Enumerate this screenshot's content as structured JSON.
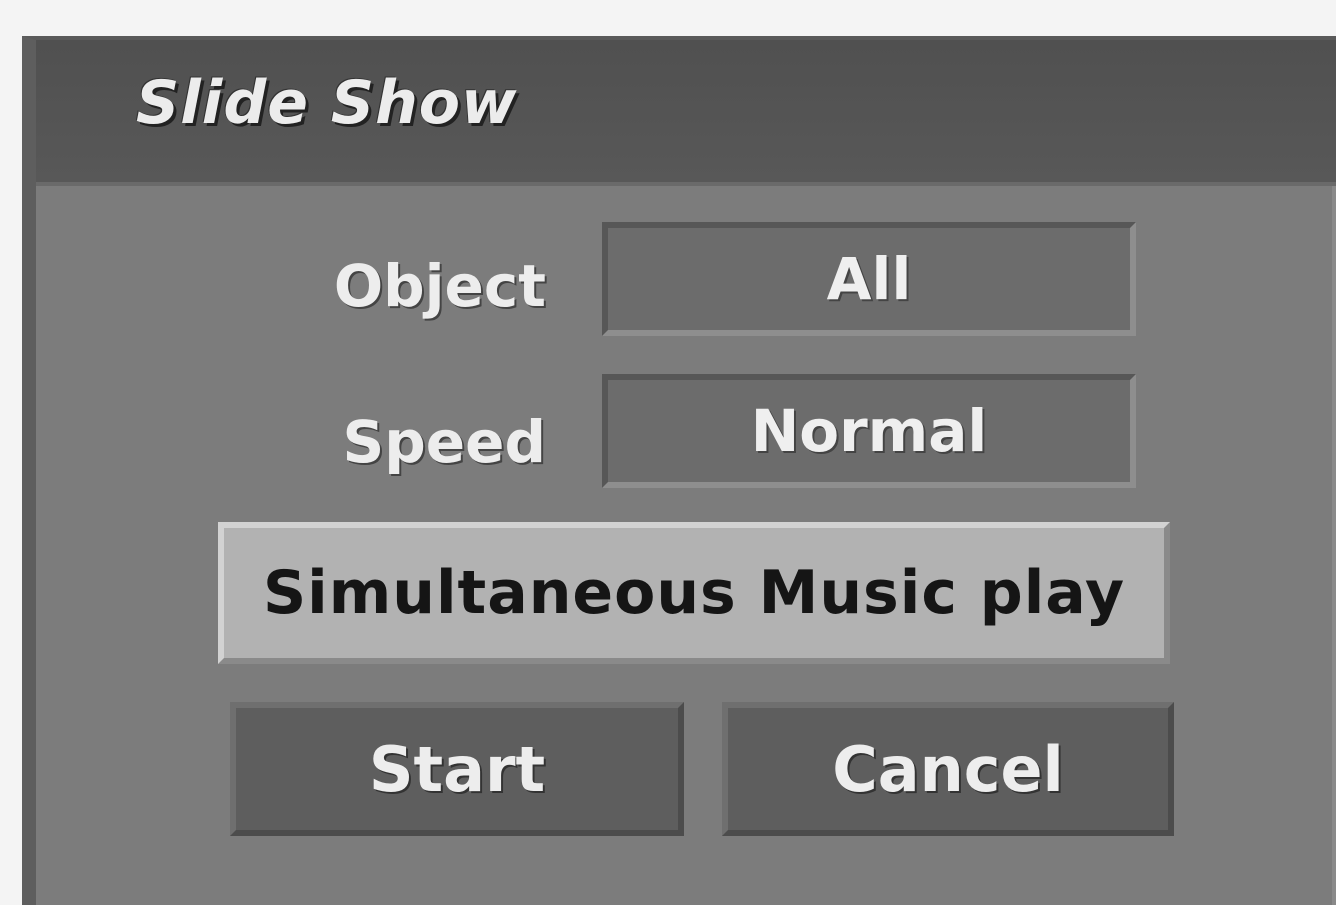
{
  "dialog": {
    "title": "Slide Show",
    "object": {
      "label": "Object",
      "value": "All"
    },
    "speed": {
      "label": "Speed",
      "value": "Normal"
    },
    "music_label": "Simultaneous Music play",
    "start_label": "Start",
    "cancel_label": "Cancel"
  }
}
